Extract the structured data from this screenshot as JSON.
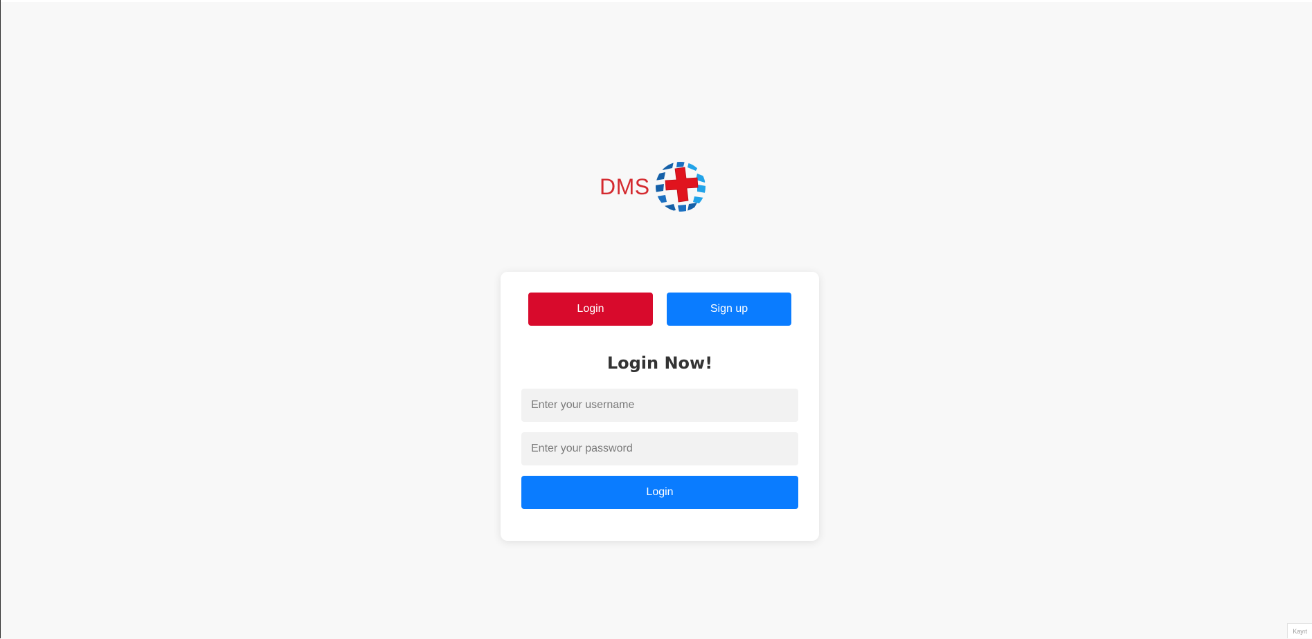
{
  "logo": {
    "text": "DMS",
    "icon": "medical-globe-cross-icon",
    "text_color": "#d42a2f"
  },
  "tabs": {
    "login_label": "Login",
    "signup_label": "Sign up",
    "login_color": "#d80a2c",
    "signup_color": "#0a7cff"
  },
  "form": {
    "title": "Login Now!",
    "username_placeholder": "Enter your username",
    "username_value": "",
    "password_placeholder": "Enter your password",
    "password_value": "",
    "submit_label": "Login",
    "submit_color": "#0a7cff"
  },
  "corner_tag": "Kayıt"
}
